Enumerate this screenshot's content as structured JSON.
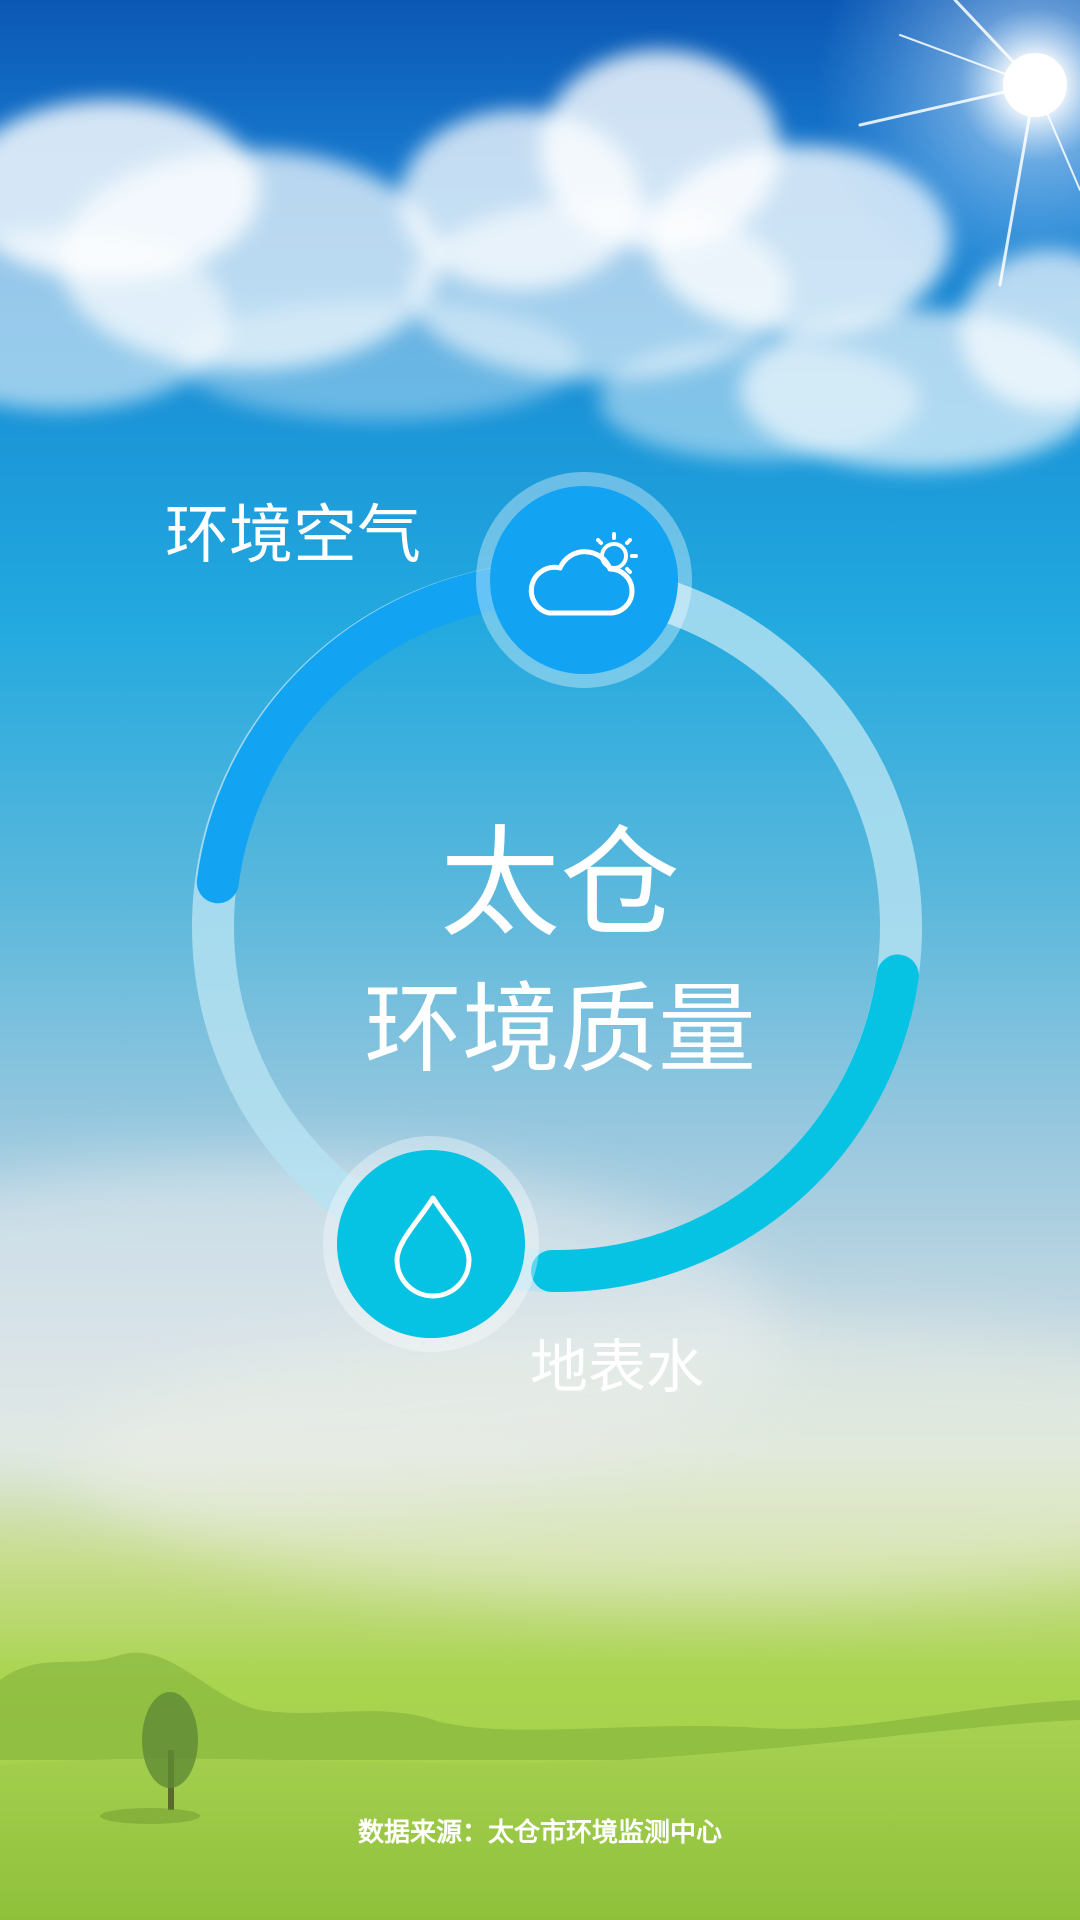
{
  "app": {
    "categories": [
      {
        "id": "air",
        "label": "环境空气",
        "icon": "cloud-sun-icon"
      },
      {
        "id": "water",
        "label": "地表水",
        "icon": "water-drop-icon"
      }
    ],
    "title_line1": "太仓",
    "title_line2": "环境质量",
    "footer": "数据来源：太仓市环境监测中心"
  },
  "colors": {
    "air_accent": "#13a3f3",
    "water_accent": "#06c2e3",
    "ring_track": "#b6e2f2"
  }
}
